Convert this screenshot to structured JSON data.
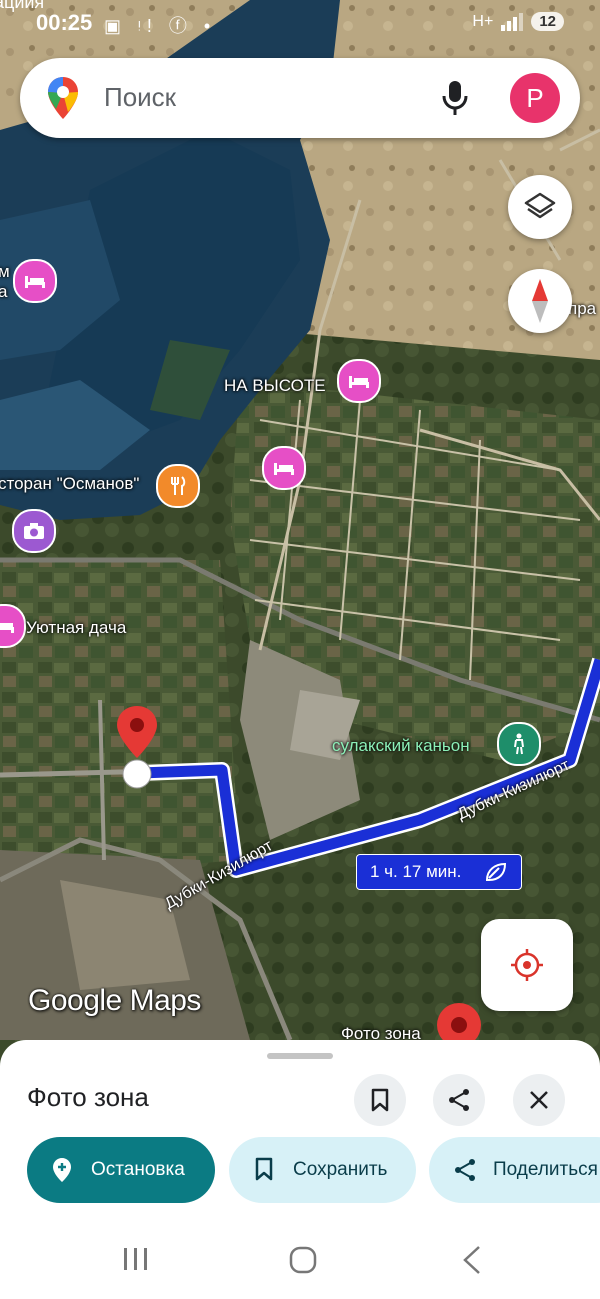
{
  "status_bar": {
    "time": "00:25",
    "edge_label": "ациия",
    "left_icons": "▣ ᵎ! ⓕ •",
    "signal": "H+",
    "battery": "12"
  },
  "search": {
    "placeholder": "Поиск",
    "avatar_letter": "P"
  },
  "map": {
    "labels": {
      "na_vysote": "НА ВЫСОТЕ",
      "restaurant": "сторан \"Османов\"",
      "uyutnaya": "Уютная дача",
      "canyon": "сулакский каньон",
      "road1": "Дубки-Кизилюрт",
      "road2": "Дубки-Кизилюрт",
      "photo_zone": "Фото зона",
      "left_edge_1": "м",
      "left_edge_2": "а",
      "right_edge": "пра"
    },
    "route_time": "1 ч. 17 мин.",
    "logo": "Google Maps"
  },
  "sheet": {
    "title": "Фото зона",
    "stop_label": "Остановка",
    "save_label": "Сохранить",
    "share_label": "Поделиться"
  },
  "colors": {
    "route": "#1a2fd6",
    "primary_button": "#0b7b83",
    "secondary_button": "#d7f1f7",
    "avatar": "#e8336b"
  }
}
